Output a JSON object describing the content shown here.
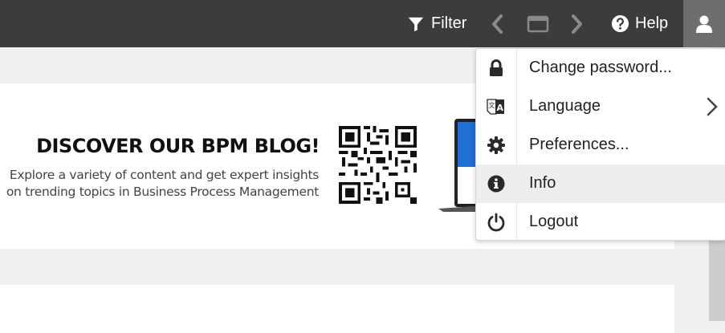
{
  "toolbar": {
    "filter_label": "Filter",
    "help_label": "Help"
  },
  "banner": {
    "title": "DISCOVER OUR BPM BLOG!",
    "text_line1": "Explore a variety of content and get expert insights",
    "text_line2": "on trending topics in Business Process Management"
  },
  "user_menu": {
    "items": [
      {
        "label": "Change password...",
        "icon": "lock-icon"
      },
      {
        "label": "Language",
        "icon": "translate-icon",
        "submenu": true
      },
      {
        "label": "Preferences...",
        "icon": "gear-icon"
      },
      {
        "label": "Info",
        "icon": "info-icon",
        "highlighted": true
      },
      {
        "label": "Logout",
        "icon": "power-icon"
      }
    ]
  },
  "colors": {
    "topbar": "#3c3c3c",
    "user_button": "#6e6e6e",
    "disabled_icon": "#8a8a8a",
    "menu_highlight": "#ededed"
  }
}
